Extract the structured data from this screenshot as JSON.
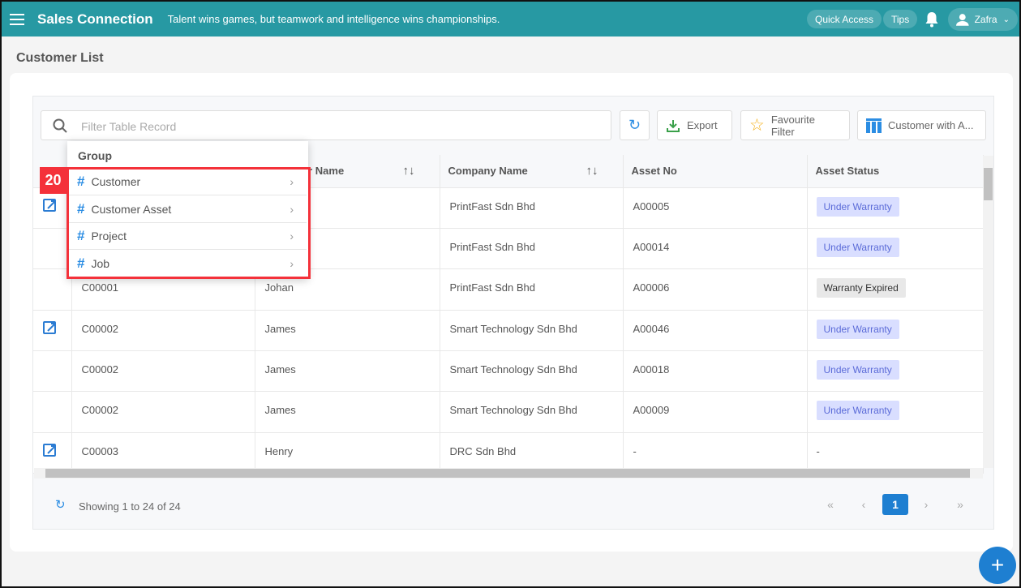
{
  "header": {
    "brand": "Sales Connection",
    "tagline": "Talent wins games, but teamwork and intelligence wins championships.",
    "quick_access": "Quick Access",
    "tips": "Tips",
    "user": "Zafra"
  },
  "page": {
    "title": "Customer List"
  },
  "toolbar": {
    "search_placeholder": "Filter Table Record",
    "export": "Export",
    "favourite": "Favourite Filter",
    "view": "Customer with A..."
  },
  "table": {
    "columns": [
      "",
      "",
      "Customer Name",
      "Company Name",
      "Asset No",
      "Asset Status"
    ],
    "rows": [
      {
        "edit": true,
        "code": "",
        "name": "",
        "company": "PrintFast Sdn Bhd",
        "asset": "A00005",
        "status": "Under Warranty"
      },
      {
        "edit": false,
        "code": "",
        "name": "",
        "company": "PrintFast Sdn Bhd",
        "asset": "A00014",
        "status": "Under Warranty"
      },
      {
        "edit": false,
        "code": "C00001",
        "name": "Johan",
        "company": "PrintFast Sdn Bhd",
        "asset": "A00006",
        "status": "Warranty Expired"
      },
      {
        "edit": true,
        "code": "C00002",
        "name": "James",
        "company": "Smart Technology Sdn Bhd",
        "asset": "A00046",
        "status": "Under Warranty"
      },
      {
        "edit": false,
        "code": "C00002",
        "name": "James",
        "company": "Smart Technology Sdn Bhd",
        "asset": "A00018",
        "status": "Under Warranty"
      },
      {
        "edit": false,
        "code": "C00002",
        "name": "James",
        "company": "Smart Technology Sdn Bhd",
        "asset": "A00009",
        "status": "Under Warranty"
      },
      {
        "edit": true,
        "code": "C00003",
        "name": "Henry",
        "company": "DRC Sdn Bhd",
        "asset": "-",
        "status": "-"
      }
    ]
  },
  "footer": {
    "showing": "Showing 1 to 24 of 24",
    "first": "«",
    "prev": "‹",
    "page": "1",
    "next": "›",
    "last": "»"
  },
  "menu": {
    "group_label": "Group",
    "items": [
      {
        "label": "Customer"
      },
      {
        "label": "Customer Asset"
      },
      {
        "label": "Project"
      },
      {
        "label": "Job"
      }
    ]
  },
  "annotation": {
    "number": "20"
  },
  "colors": {
    "header": "#2799a3",
    "accent": "#1e7fd1",
    "highlight": "#f4313a"
  }
}
